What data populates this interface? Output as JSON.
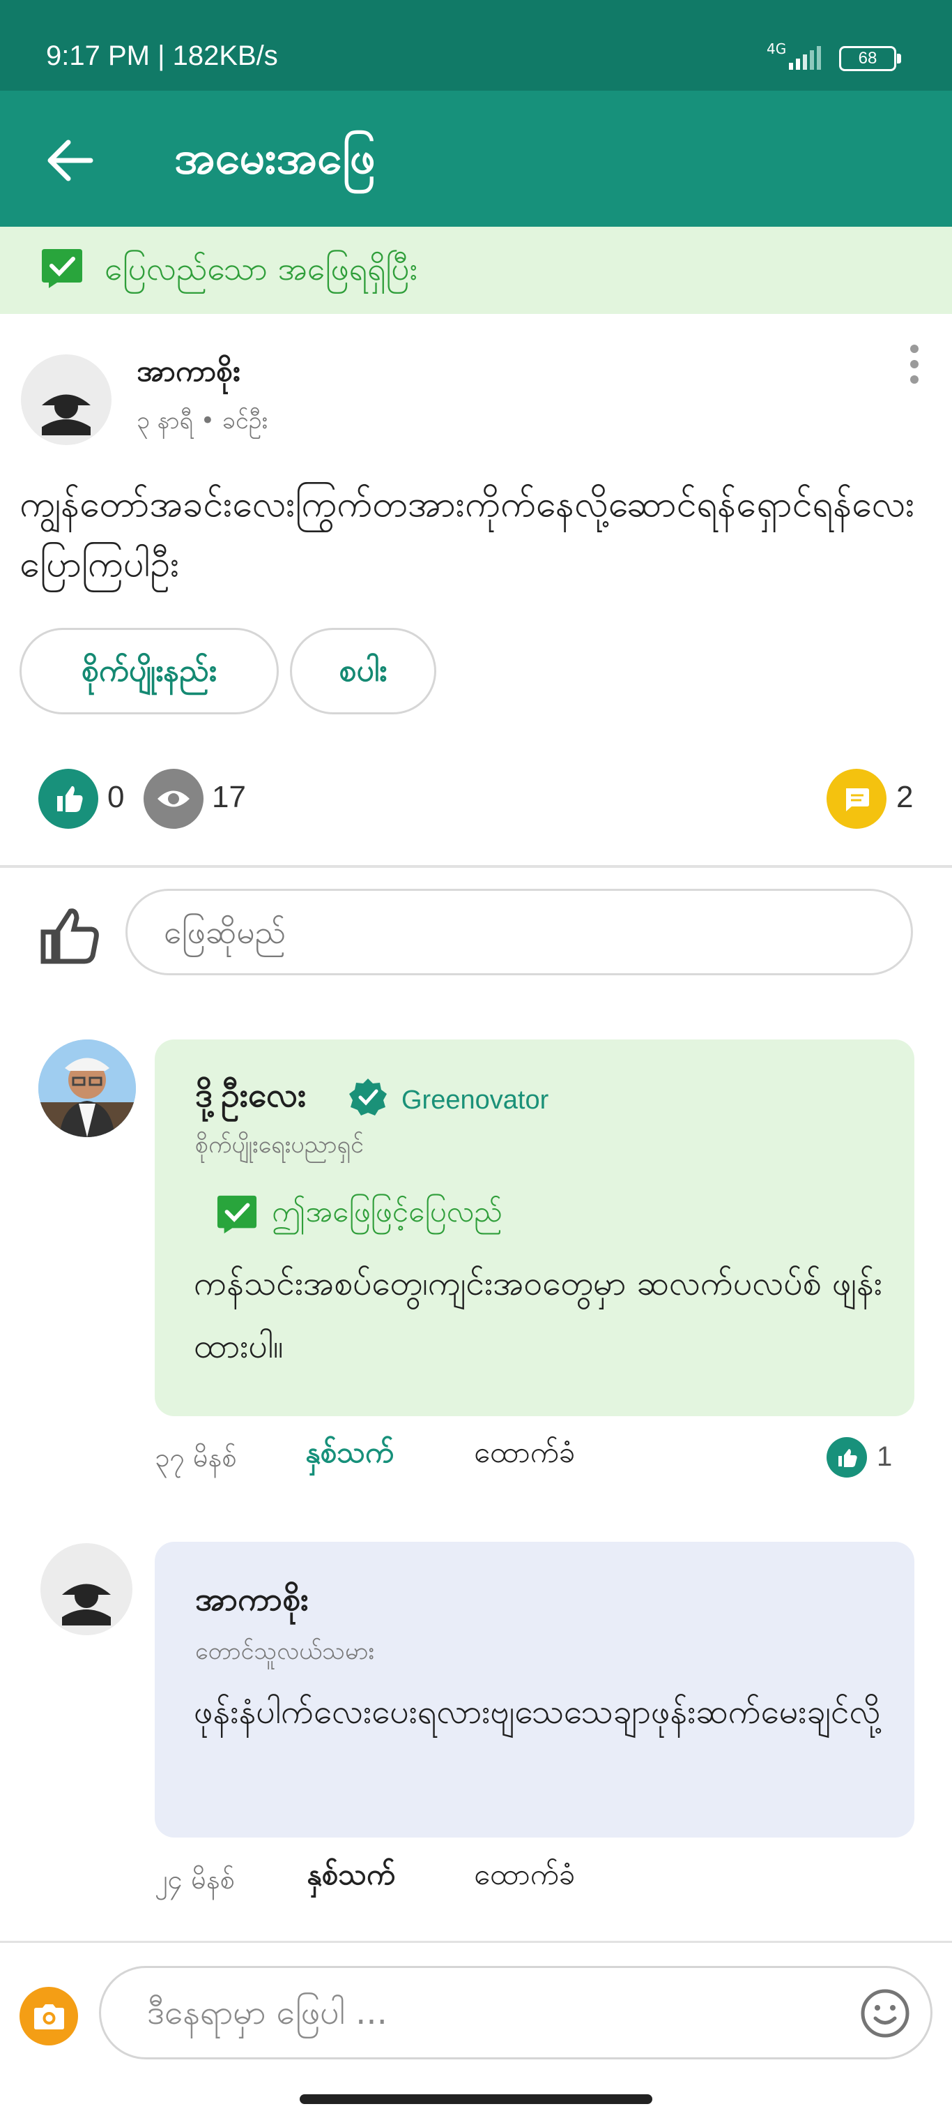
{
  "status_bar": {
    "time": "9:17 PM | 182KB/s",
    "network": "4G",
    "battery": "68"
  },
  "app_bar": {
    "title": "အမေးအဖြေ"
  },
  "answered_banner": {
    "text": "ပြေလည်သော အဖြေရရှိပြီး"
  },
  "question": {
    "author": "အာကာစိုး",
    "meta": "၃ နာရီ • ခင်ဦး",
    "text": "ကျွန်တော်အခင်းလေးကြွက်တအားကိုက်နေလို့ဆောင်ရန်ရှောင်ရန်လေးပြောကြပါဦး",
    "tags": [
      "စိုက်ပျိုးနည်း",
      "စပါး"
    ],
    "likes": "0",
    "views": "17",
    "comments": "2"
  },
  "answer_input": {
    "placeholder": "ဖြေဆိုမည်"
  },
  "comments": [
    {
      "name": "ဒို့ဦးလေး",
      "badge": "Greenovator",
      "role": "စိုက်ပျိုးရေးပညာရှင်",
      "accepted_label": "ဤအဖြေဖြင့်ပြေလည်",
      "body": "ကန်သင်းအစပ်တွေ၊ကျင်းအဝတွေမှာ ဆလက်ပလပ်စ် ဖျန်းထားပါ။",
      "time": "၃၇ မိနစ်",
      "thanks": "နှစ်သက်",
      "reply": "ထောက်ခံ",
      "likes": "1"
    },
    {
      "name": "အာကာစိုး",
      "role": "တောင်သူလယ်သမား",
      "body": "ဖုန်းနံပါက်လေးပေးရလားဗျသေသေချာဖုန်းဆက်မေးချင်လို့",
      "time": "၂၄ မိနစ်",
      "thanks": "နှစ်သက်",
      "reply": "ထောက်ခံ"
    }
  ],
  "reply_input": {
    "placeholder": "ဒီနေရာမှာ ဖြေပါ ..."
  },
  "colors": {
    "primary": "#17917b",
    "status_bar": "#117a67",
    "accepted_green": "#2f9e3a",
    "banner_bg": "#e2f5dd",
    "comment_bg": "#e9edf8",
    "comment_icon": "#f4c20f",
    "camera_button": "#f49e15"
  },
  "icons": [
    "back-arrow-icon",
    "check-square-icon",
    "more-vertical-icon",
    "thumb-up-icon",
    "eye-icon",
    "comment-icon",
    "verified-icon",
    "camera-icon",
    "emoji-icon"
  ]
}
